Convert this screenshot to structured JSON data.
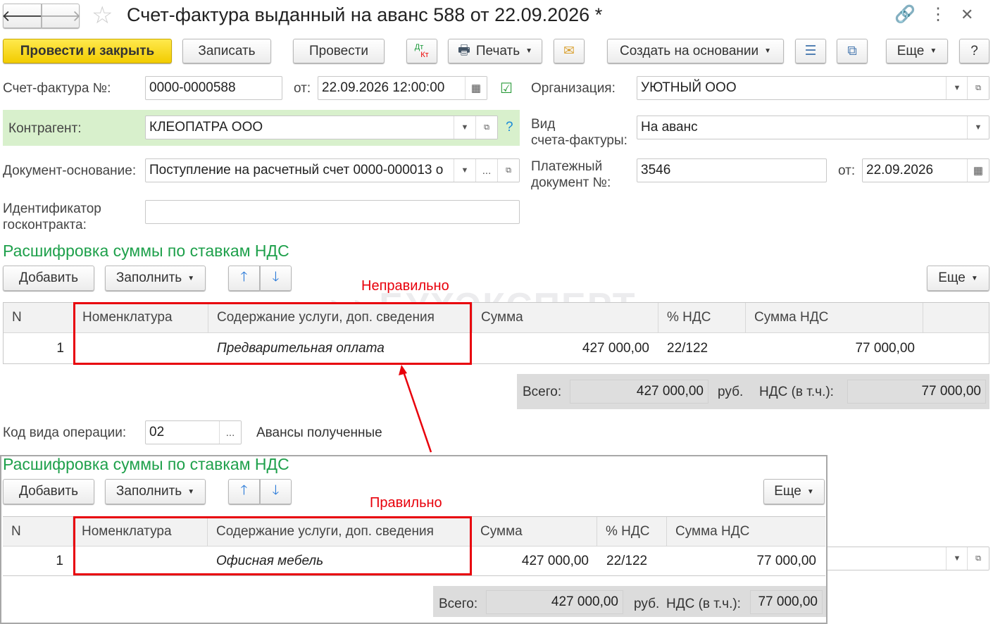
{
  "title": "Счет-фактура выданный на аванс 588 от 22.09.2026 *",
  "toolbar": {
    "post_close": "Провести и закрыть",
    "save": "Записать",
    "post": "Провести",
    "dtkt_dt": "Дт",
    "dtkt_kt": "Кт",
    "print": "Печать",
    "create_based": "Создать на основании",
    "more": "Еще",
    "help": "?"
  },
  "form": {
    "invoice_no_label": "Счет-фактура №:",
    "invoice_no": "0000-0000588",
    "from_label": "от:",
    "invoice_date": "22.09.2026 12:00:00",
    "org_label": "Организация:",
    "org": "УЮТНЫЙ ООО",
    "contractor_label": "Контрагент:",
    "contractor": "КЛЕОПАТРА ООО",
    "help": "?",
    "kind_label_1": "Вид",
    "kind_label_2": "счета-фактуры:",
    "kind": "На аванс",
    "base_doc_label": "Документ-основание:",
    "base_doc": "Поступление на расчетный счет 0000-000013 о",
    "paydoc_label_1": "Платежный",
    "paydoc_label_2": "документ №:",
    "paydoc": "3546",
    "paydoc_from_label": "от:",
    "paydoc_date": "22.09.2026",
    "gov_label_1": "Идентификатор",
    "gov_label_2": "госконтракта:",
    "gov": "",
    "opcode_label": "Код вида операции:",
    "opcode": "02",
    "opcode_desc": "Авансы полученные"
  },
  "section1": {
    "title": "Расшифровка суммы по ставкам НДС",
    "add": "Добавить",
    "fill": "Заполнить",
    "more": "Еще",
    "annotation": "Неправильно",
    "columns": [
      "N",
      "Номенклатура",
      "Содержание услуги, доп. сведения",
      "Сумма",
      "% НДС",
      "Сумма НДС"
    ],
    "rows": [
      {
        "n": "1",
        "nomenclature": "",
        "content": "Предварительная оплата",
        "sum": "427 000,00",
        "rate": "22/122",
        "vat": "77 000,00"
      }
    ],
    "total_label": "Всего:",
    "total": "427 000,00",
    "currency": "руб.",
    "vat_label": "НДС (в т.ч.):",
    "vat_total": "77 000,00"
  },
  "section2": {
    "title": "Расшифровка суммы по ставкам НДС",
    "add": "Добавить",
    "fill": "Заполнить",
    "more": "Еще",
    "annotation": "Правильно",
    "columns": [
      "N",
      "Номенклатура",
      "Содержание услуги, доп. сведения",
      "Сумма",
      "% НДС",
      "Сумма НДС"
    ],
    "rows": [
      {
        "n": "1",
        "nomenclature": "",
        "content": "Офисная мебель",
        "sum": "427 000,00",
        "rate": "22/122",
        "vat": "77 000,00"
      }
    ],
    "total_label": "Всего:",
    "total": "427 000,00",
    "currency": "руб.",
    "vat_label": "НДС (в т.ч.):",
    "vat_total": "77 000,00"
  },
  "watermark": "БУХЭКСПЕРТ",
  "colors": {
    "accent_green": "#1ea04b",
    "annotation_red": "#e8000b",
    "primary_yellow": "#f7d918"
  }
}
